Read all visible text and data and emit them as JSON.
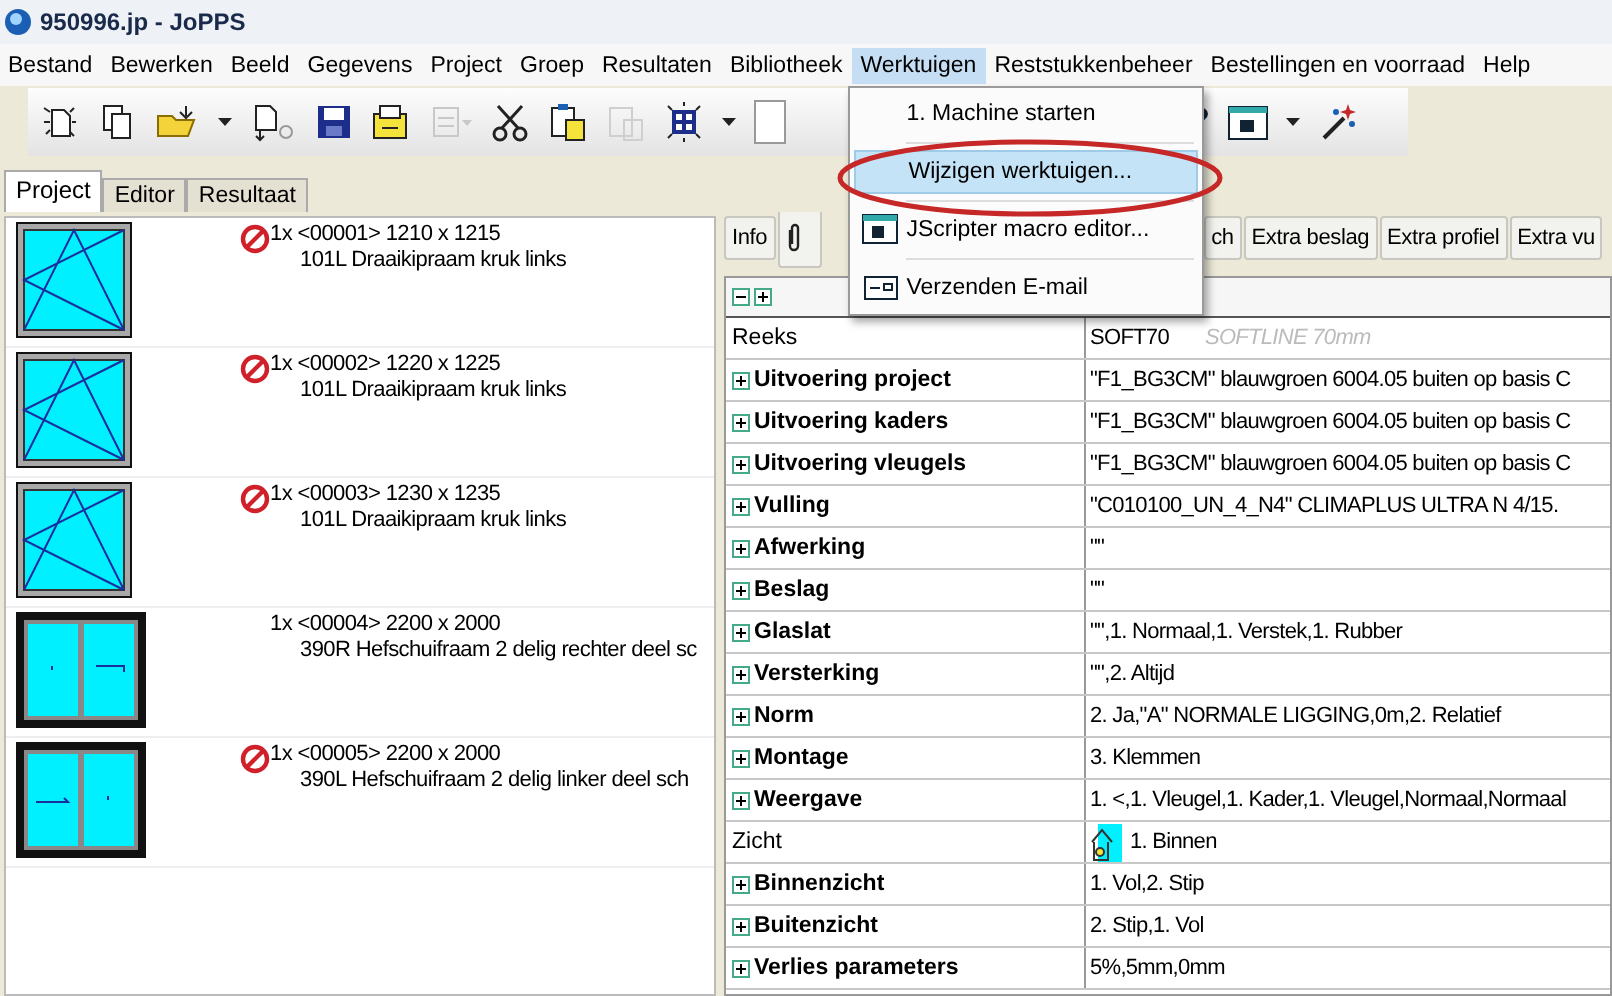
{
  "window": {
    "title": "950996.jp - JoPPS"
  },
  "menu_bar": [
    {
      "label": "Bestand",
      "selected": false
    },
    {
      "label": "Bewerken",
      "selected": false
    },
    {
      "label": "Beeld",
      "selected": false
    },
    {
      "label": "Gegevens",
      "selected": false
    },
    {
      "label": "Project",
      "selected": false
    },
    {
      "label": "Groep",
      "selected": false
    },
    {
      "label": "Resultaten",
      "selected": false
    },
    {
      "label": "Bibliotheek",
      "selected": false
    },
    {
      "label": "Werktuigen",
      "selected": true
    },
    {
      "label": "Reststukkenbeheer",
      "selected": false
    },
    {
      "label": "Bestellingen en voorraad",
      "selected": false
    },
    {
      "label": "Help",
      "selected": false
    }
  ],
  "dropdown": [
    {
      "label": "1. Machine starten",
      "kind": "plain",
      "selected": false
    },
    {
      "label": "Wijzigen werktuigen...",
      "kind": "plain",
      "selected": true
    },
    {
      "label": "JScripter macro editor...",
      "kind": "script",
      "selected": false
    },
    {
      "label": "Verzenden E-mail",
      "kind": "email",
      "selected": false
    }
  ],
  "tabs": [
    {
      "label": "Project",
      "selected": true
    },
    {
      "label": "Editor",
      "selected": false
    },
    {
      "label": "Resultaat",
      "selected": false
    }
  ],
  "positions": [
    {
      "kind": "tilt",
      "blocked": true,
      "line_1": "1x <00001> 1210 x 1215",
      "line_2": "101L Draaikipraam kruk links"
    },
    {
      "kind": "tilt",
      "blocked": true,
      "line_1": "1x <00002> 1220 x 1225",
      "line_2": "101L Draaikipraam kruk links"
    },
    {
      "kind": "tilt",
      "blocked": true,
      "line_1": "1x <00003> 1230 x 1235",
      "line_2": "101L Draaikipraam kruk links"
    },
    {
      "kind": "sliding-right",
      "blocked": false,
      "line_1": "1x <00004> 2200 x 2000",
      "line_2": "390R Hefschuifraam 2 delig rechter deel sc"
    },
    {
      "kind": "sliding-left",
      "blocked": true,
      "line_1": "1x <00005> 2200 x 2000",
      "line_2": "390L Hefschuifraam 2 delig linker deel sch"
    }
  ],
  "detail_buttons": [
    "Info",
    "ch",
    "Extra beslag",
    "Extra profiel",
    "Extra vu"
  ],
  "properties": [
    {
      "label": "Reeks",
      "expandable": false,
      "value": "SOFT70",
      "note": "SOFTLINE 70mm"
    },
    {
      "label": "Uitvoering project",
      "expandable": true,
      "value": "\"F1_BG3CM\" blauwgroen 6004.05 buiten op basis C"
    },
    {
      "label": "Uitvoering kaders",
      "expandable": true,
      "value": "\"F1_BG3CM\" blauwgroen 6004.05 buiten op basis C"
    },
    {
      "label": "Uitvoering vleugels",
      "expandable": true,
      "value": "\"F1_BG3CM\" blauwgroen 6004.05 buiten op basis C"
    },
    {
      "label": "Vulling",
      "expandable": true,
      "value": "\"C010100_UN_4_N4\" CLIMAPLUS ULTRA N 4/15."
    },
    {
      "label": "Afwerking",
      "expandable": true,
      "value": "\"\""
    },
    {
      "label": "Beslag",
      "expandable": true,
      "value": "\"\""
    },
    {
      "label": "Glaslat",
      "expandable": true,
      "value": "\"\",1. Normaal,1. Verstek,1. Rubber"
    },
    {
      "label": "Versterking",
      "expandable": true,
      "value": "\"\",2. Altijd"
    },
    {
      "label": "Norm",
      "expandable": true,
      "value": "2. Ja,\"A\" NORMALE LIGGING,0m,2. Relatief"
    },
    {
      "label": "Montage",
      "expandable": true,
      "value": "3. Klemmen"
    },
    {
      "label": "Weergave",
      "expandable": true,
      "value": "1. <,1. Vleugel,1. Kader,1. Vleugel,Normaal,Normaal"
    },
    {
      "label": "Zicht",
      "expandable": false,
      "value": "1. Binnen",
      "kind": "view"
    },
    {
      "label": "Binnenzicht",
      "expandable": true,
      "value": "1. Vol,2. Stip"
    },
    {
      "label": "Buitenzicht",
      "expandable": true,
      "value": "2. Stip,1. Vol"
    },
    {
      "label": "Verlies parameters",
      "expandable": true,
      "value": "5%,5mm,0mm"
    }
  ]
}
